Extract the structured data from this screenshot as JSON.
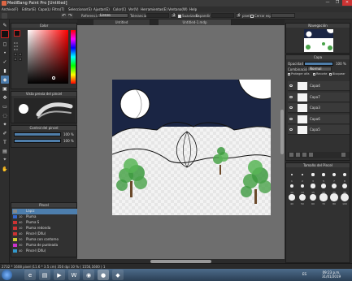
{
  "window": {
    "title": "MediBang Paint Pro [Untitled]",
    "controls": [
      "—",
      "❐",
      "✕"
    ]
  },
  "menu": [
    "Archivo(F)",
    "Editar(E)",
    "Capa(L)",
    "Filtro(T)",
    "Seleccionar(S)",
    "Ajustar(E)",
    "Color(C)",
    "Ver(V)",
    "Herramientas(E)",
    "Ventana(W)",
    "Help"
  ],
  "toolbar": {
    "reference_label": "Referencia",
    "reference_value": "Lienzo",
    "tolerance_label": "Tolerancia",
    "tolerance_value": "2",
    "antialias_label": "Suavizado",
    "expand_label": "Expandir",
    "expand_value": "0",
    "px_label": "pixel",
    "close_gaps_label": "Cerrar espacios"
  },
  "tabs": [
    "Untitled",
    "Untitled-1.mdp"
  ],
  "panels": {
    "color": "Color",
    "brush_preview": "Vista previa del pincel",
    "brush_control": "Control del pincel",
    "pencil": "Pincel",
    "navigator": "Navegación",
    "layer": "Capa",
    "brush_size": "Tamaño del Pincel"
  },
  "color": {
    "r": "R 0",
    "g": "G 0",
    "b": "B 0"
  },
  "brush_control": {
    "size_value": "100 %",
    "opacity_value": "100 %",
    "size_fraction": 1.0,
    "opacity_fraction": 1.0
  },
  "pencils": [
    {
      "size": "",
      "name": "Lápiz",
      "color": "#888888",
      "selected": true
    },
    {
      "size": "10",
      "name": "Pluma",
      "color": "#3366cc"
    },
    {
      "size": "40",
      "name": "Pluma S",
      "color": "#cc3333"
    },
    {
      "size": "10",
      "name": "Pluma redonda",
      "color": "#cc3333"
    },
    {
      "size": "40",
      "name": "Pincel (Difu)",
      "color": "#cc3333"
    },
    {
      "size": "20",
      "name": "Pluma con contorno",
      "color": "#cccc33"
    },
    {
      "size": "30",
      "name": "Pluma de punteada",
      "color": "#cc33cc"
    },
    {
      "size": "40",
      "name": "Pincel (Difu)",
      "color": "#3399cc"
    }
  ],
  "layer": {
    "opacity_label": "Opacidad",
    "opacity_value": "100 %",
    "blend_label": "Combinación",
    "blend_value": "Normal",
    "protect_alpha": "Proteger alfa",
    "clipping": "Recorte",
    "lock": "Bloquear",
    "layers": [
      "Capa4",
      "Capa7",
      "Capa3",
      "Capa6",
      "Capa5"
    ]
  },
  "brush_sizes": [
    "1",
    "2",
    "3",
    "5",
    "7",
    "8",
    "10",
    "13",
    "15",
    "20",
    "25",
    "30",
    "40",
    "50",
    "60",
    "70",
    "80",
    "100"
  ],
  "status": {
    "dims": "2732 * 1608 pixel (11.6 * 3.5 cm) 350 dpi 10 % ( 1556,1600 ) 1"
  },
  "taskbar": {
    "lang": "ES",
    "time": "09:23 p.m.",
    "date": "31/01/2019"
  },
  "colors": {
    "accent": "#4d7ead",
    "sky": "#1a2544",
    "tree": "#4aa34a"
  }
}
